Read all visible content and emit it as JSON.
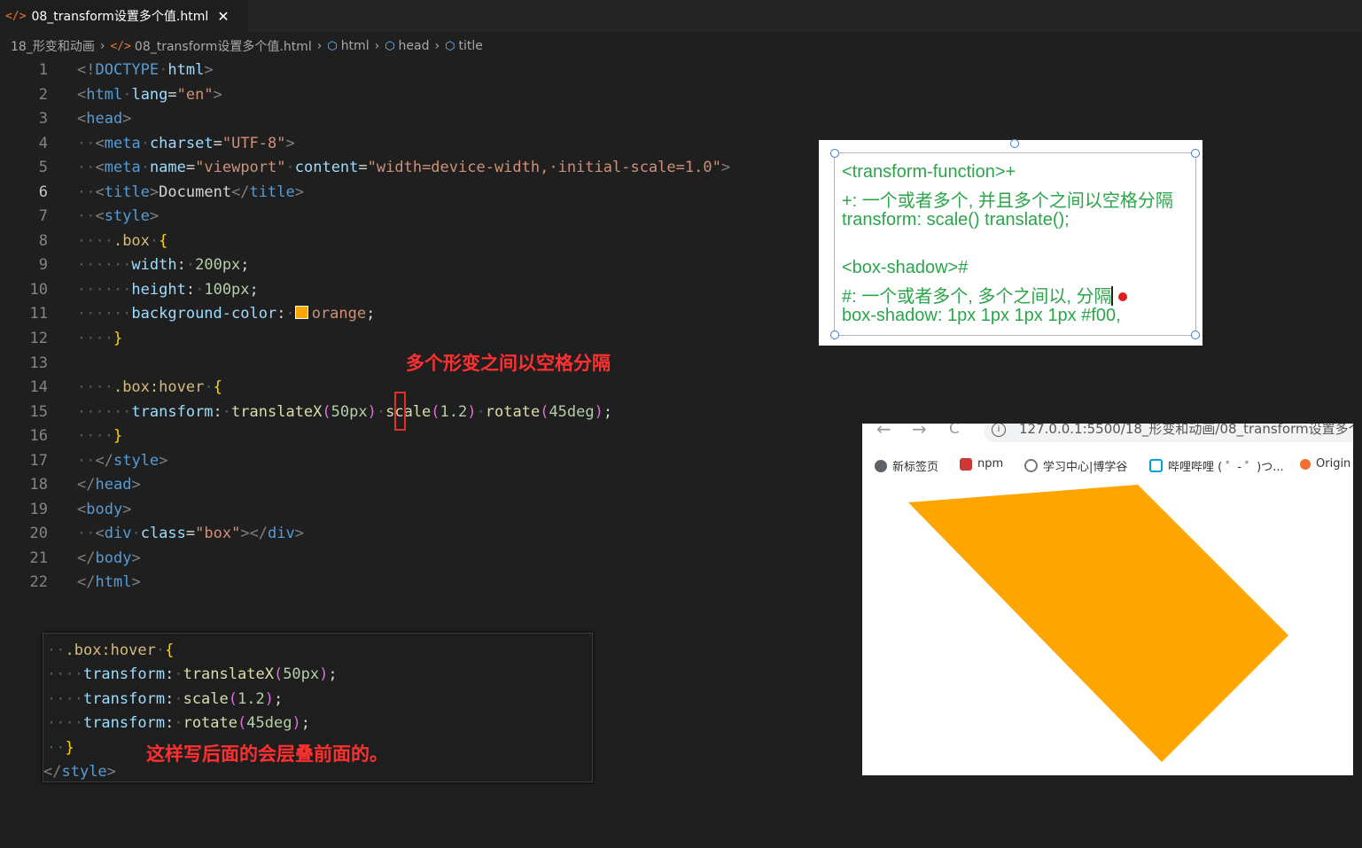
{
  "tab": {
    "icon": "</>",
    "filename": "08_transform设置多个值.html",
    "close": "✕"
  },
  "breadcrumb": {
    "folder": "18_形变和动画",
    "file": "08_transform设置多个值.html",
    "items": [
      "html",
      "head",
      "title"
    ]
  },
  "editor": {
    "active_line": 6,
    "line_numbers": [
      "1",
      "2",
      "3",
      "4",
      "5",
      "6",
      "7",
      "8",
      "9",
      "10",
      "11",
      "12",
      "13",
      "14",
      "15",
      "16",
      "17",
      "18",
      "19",
      "20",
      "21",
      "22"
    ]
  },
  "annotations": {
    "spaces_note": "多个形变之间以空格分隔",
    "override_note": "这样写后面的会层叠前面的。"
  },
  "note": {
    "lines": [
      "<transform-function>+",
      "+: 一个或者多个, 并且多个之间以空格分隔",
      "transform: scale() translate();",
      "",
      "<box-shadow>#",
      "#: 一个或者多个, 多个之间以, 分隔",
      "box-shadow: 1px 1px 1px 1px #f00,"
    ]
  },
  "browser": {
    "back": "←",
    "forward": "→",
    "reload": "C",
    "url": "127.0.0.1:5500/18_形变和动画/08_transform设置多个",
    "bookmarks": [
      "新标签页",
      "npm",
      "学习中心|博学谷",
      "哔哩哔哩 ( ゜- ゜)つ...",
      "Origin"
    ],
    "box_color": "#ffa500"
  },
  "colors": {
    "accent_red": "#ff3030",
    "note_green": "#2aa54a"
  }
}
